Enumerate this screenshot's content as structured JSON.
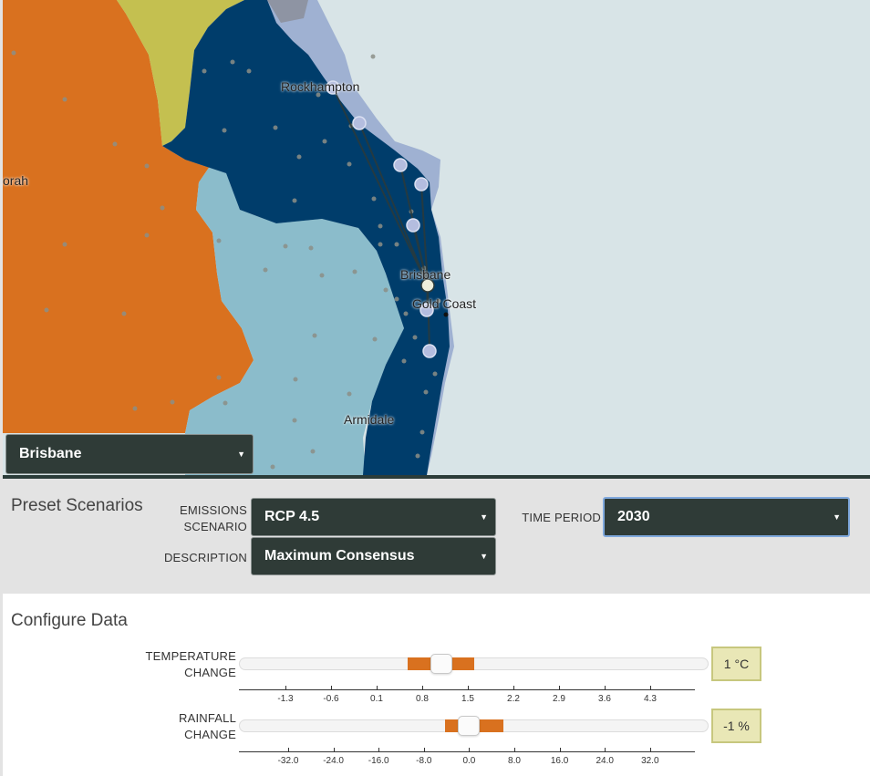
{
  "map": {
    "labels": {
      "rockhampton": "Rockhampton",
      "orah": "orah",
      "brisbane": "Brisbane",
      "gold_coast": "Gold Coast",
      "armidale": "Armidale"
    },
    "region_select": {
      "value": "Brisbane"
    }
  },
  "preset": {
    "title": "Preset Scenarios",
    "emissions_label_1": "EMISSIONS",
    "emissions_label_2": "SCENARIO",
    "emissions_value": "RCP 4.5",
    "description_label": "DESCRIPTION",
    "description_value": "Maximum Consensus",
    "time_label": "TIME PERIOD",
    "time_value": "2030"
  },
  "configure": {
    "title": "Configure Data",
    "temperature": {
      "label_1": "TEMPERATURE",
      "label_2": "CHANGE",
      "value_text": "1 °C",
      "ticks": [
        "-1.3",
        "-0.6",
        "0.1",
        "0.8",
        "1.5",
        "2.2",
        "2.9",
        "3.6",
        "4.3"
      ]
    },
    "rainfall": {
      "label_1": "RAINFALL",
      "label_2": "CHANGE",
      "value_text": "-1 %",
      "ticks": [
        "-32.0",
        "-24.0",
        "-16.0",
        "-8.0",
        "0.0",
        "8.0",
        "16.0",
        "24.0",
        "32.0"
      ]
    }
  },
  "colors": {
    "accent_orange": "#d9711f",
    "select_dark": "#2f3b37",
    "region_navy": "#003d6b"
  }
}
